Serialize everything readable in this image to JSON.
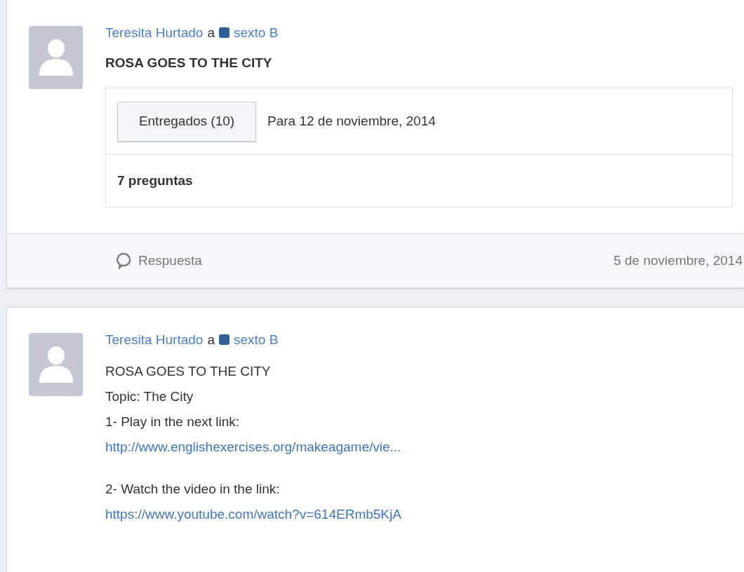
{
  "posts": [
    {
      "author": "Teresita Hurtado",
      "connector": "a",
      "group": "sexto B",
      "kind": "assignment",
      "title": "ROSA GOES TO THE CITY",
      "assignment": {
        "button": "Entregados (10)",
        "due": "Para 12 de noviembre, 2014",
        "questions": "7 preguntas"
      },
      "footer": {
        "reply": "Respuesta",
        "date": "5 de noviembre, 2014"
      }
    },
    {
      "author": "Teresita Hurtado",
      "connector": "a",
      "group": "sexto B",
      "kind": "note",
      "paragraphs": [
        [
          {
            "kind": "text",
            "text": "ROSA GOES TO THE CITY"
          },
          {
            "kind": "text",
            "text": "Topic: The City"
          },
          {
            "kind": "text",
            "text": "1- Play in the next link:"
          },
          {
            "kind": "link",
            "text": "http://www.englishexercises.org/makeagame/vie..."
          }
        ],
        [
          {
            "kind": "text",
            "text": "2- Watch the video in the link:"
          },
          {
            "kind": "link",
            "text": "https://www.youtube.com/watch?v=614ERmb5KjA"
          }
        ]
      ]
    }
  ]
}
